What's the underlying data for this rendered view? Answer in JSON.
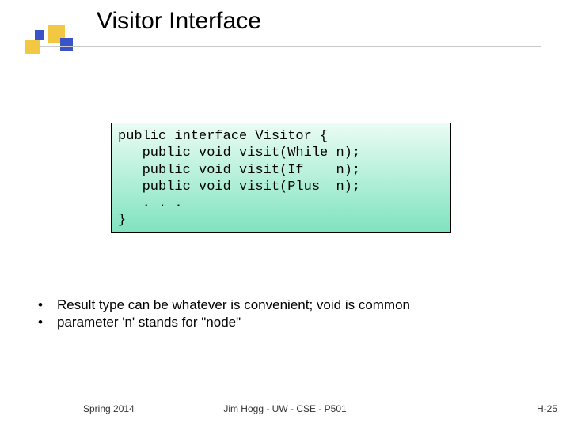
{
  "title": "Visitor Interface",
  "code": {
    "l1": "public interface Visitor {",
    "l2": "   public void visit(While n);",
    "l3": "   public void visit(If    n);",
    "l4": "   public void visit(Plus  n);",
    "l5": "   . . .",
    "l6": "}"
  },
  "bullets": {
    "b1": "Result type can be whatever is convenient; void is common",
    "b2": "parameter 'n' stands for \"node\""
  },
  "footer": {
    "left": "Spring 2014",
    "center": "Jim Hogg - UW - CSE - P501",
    "right": "H-25"
  }
}
